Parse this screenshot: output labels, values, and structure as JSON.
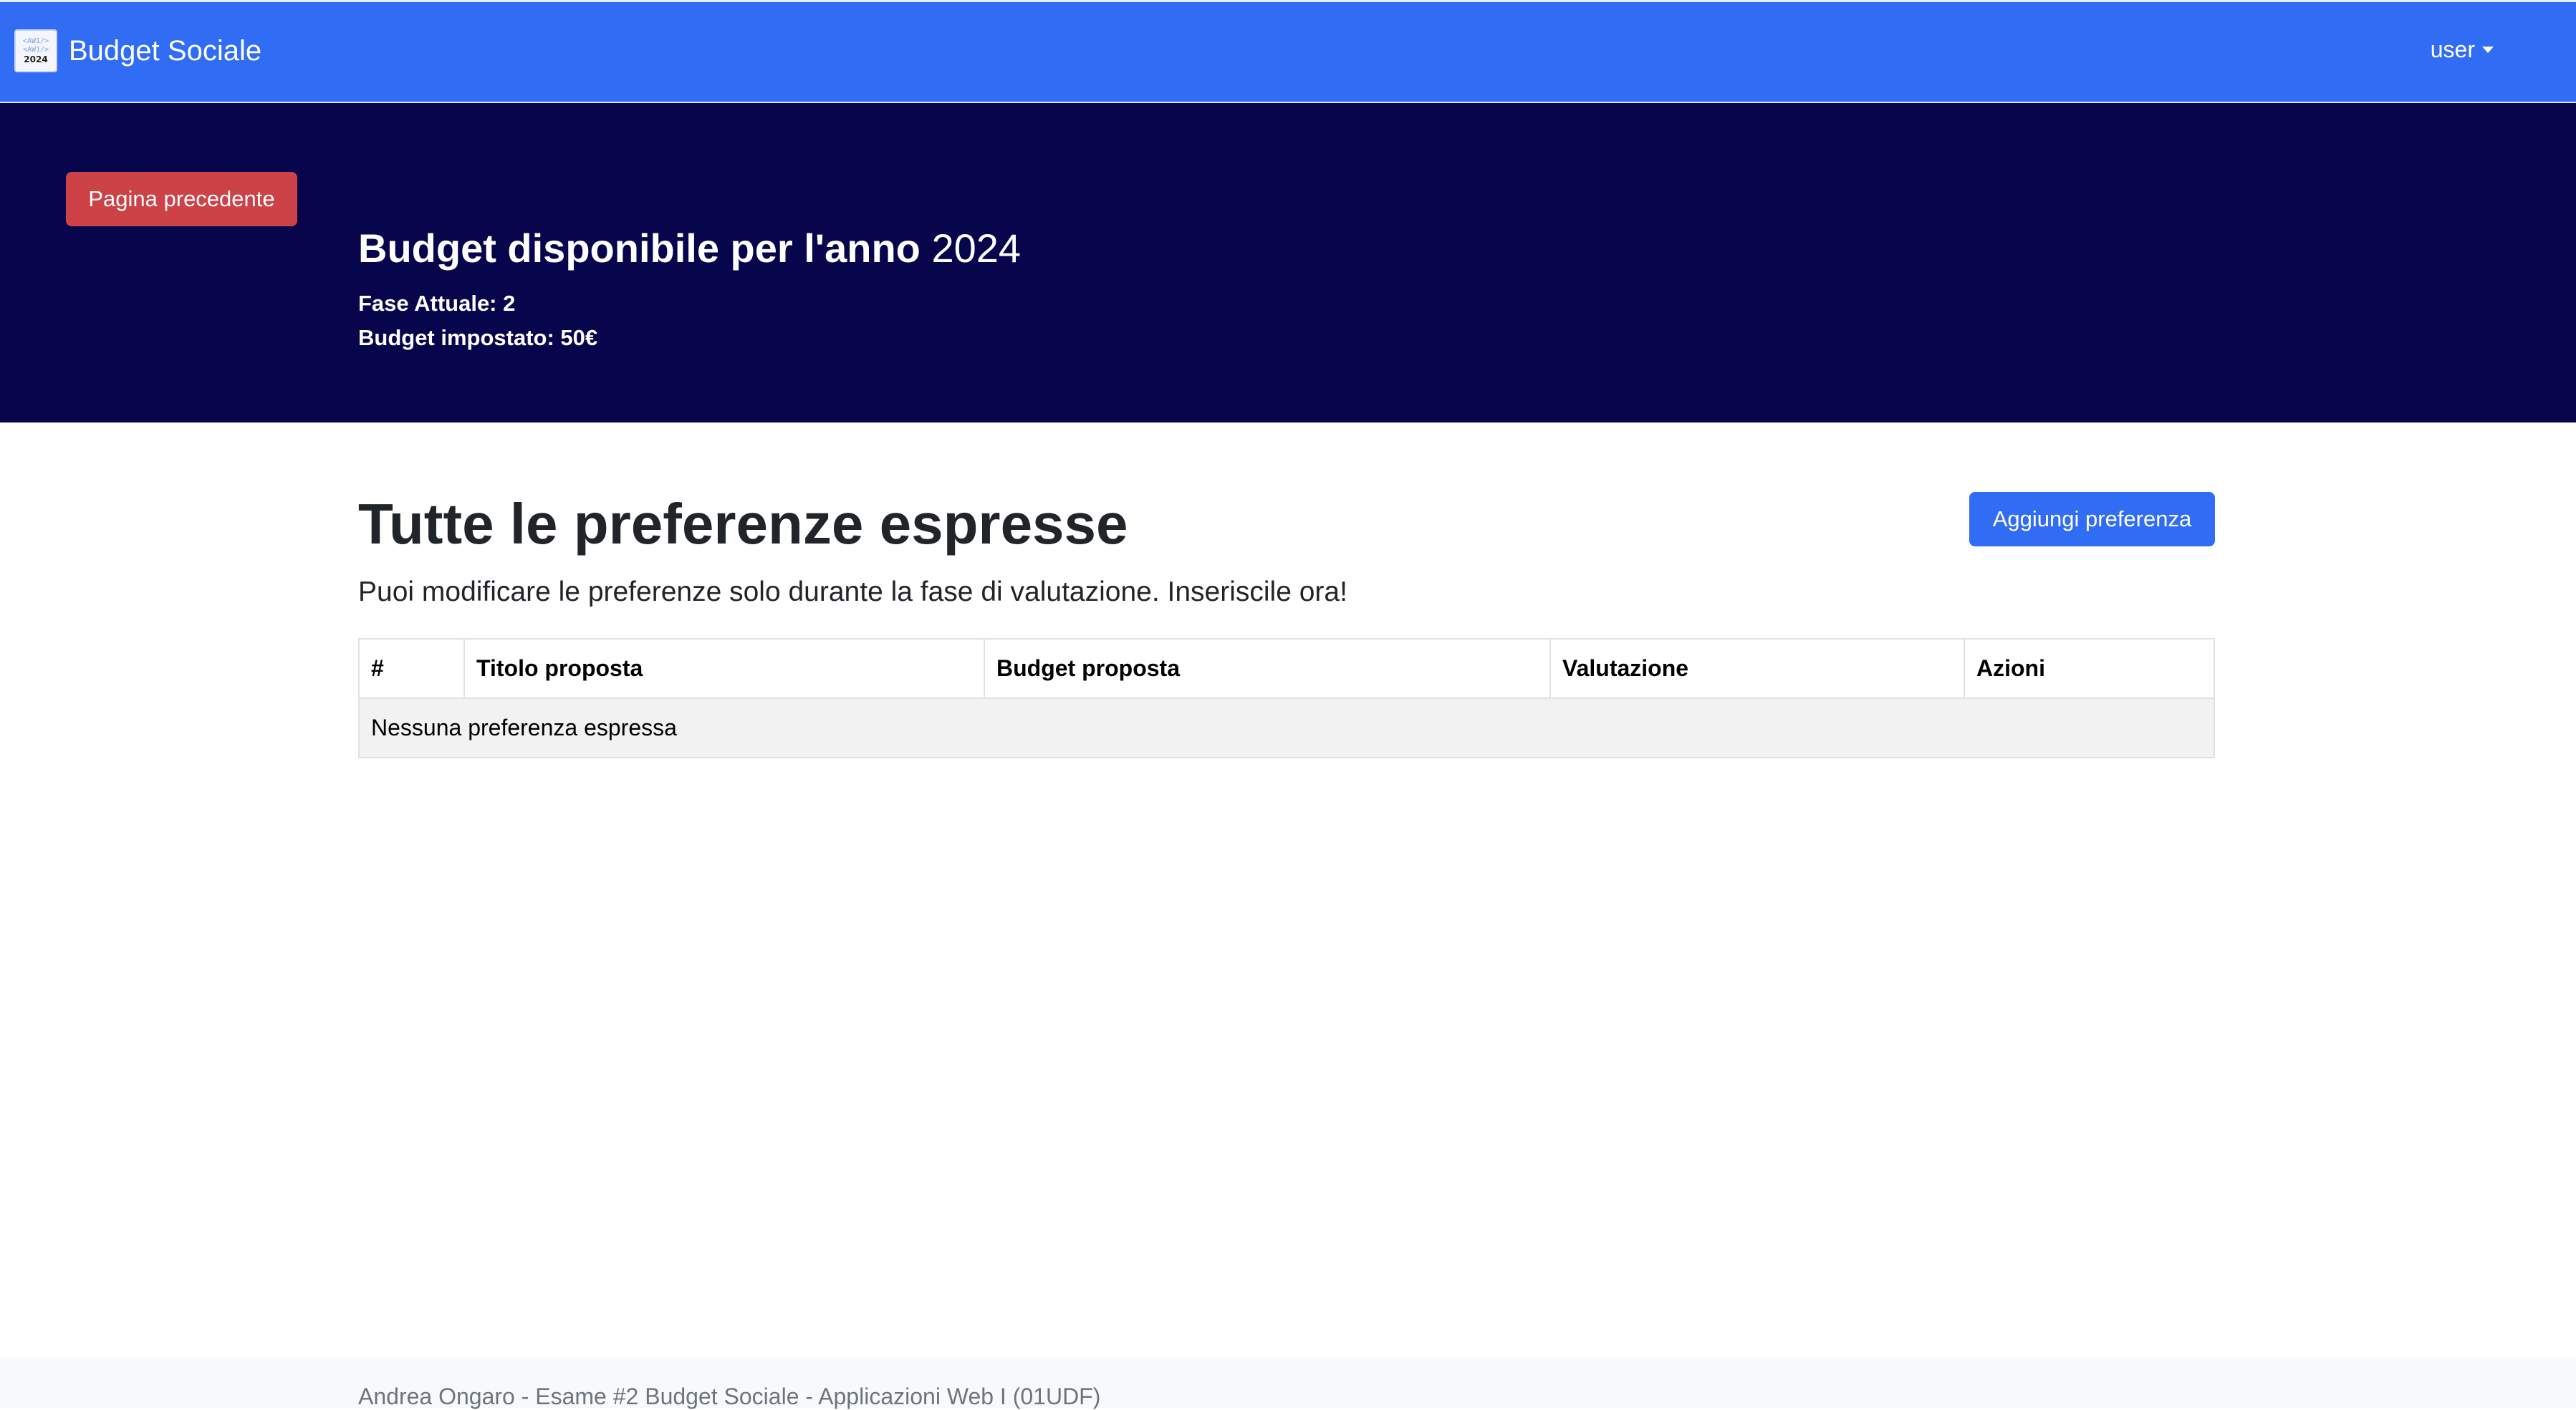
{
  "navbar": {
    "logo_text_top": "<AW1/>",
    "logo_text_mid": "<AW1/>",
    "logo_year": "2024",
    "brand": "Budget Sociale",
    "user": "user"
  },
  "hero": {
    "back_button": "Pagina precedente",
    "title": "Budget disponibile per l'anno",
    "year": "2024",
    "phase": "Fase Attuale: 2",
    "budget": "Budget impostato: 50€"
  },
  "main": {
    "title": "Tutte le preferenze espresse",
    "add_button": "Aggiungi preferenza",
    "lead": "Puoi modificare le preferenze solo durante la fase di valutazione. Inseriscile ora!",
    "table": {
      "headers": [
        "#",
        "Titolo proposta",
        "Budget proposta",
        "Valutazione",
        "Azioni"
      ],
      "empty_message": "Nessuna preferenza espressa"
    }
  },
  "footer": {
    "text": "Andrea Ongaro - Esame #2 Budget Sociale - Applicazioni Web I (01UDF)"
  },
  "colors": {
    "navbar": "#316cf4",
    "hero": "#07064c",
    "back_button": "#cc4247",
    "add_button": "#316cf4"
  }
}
